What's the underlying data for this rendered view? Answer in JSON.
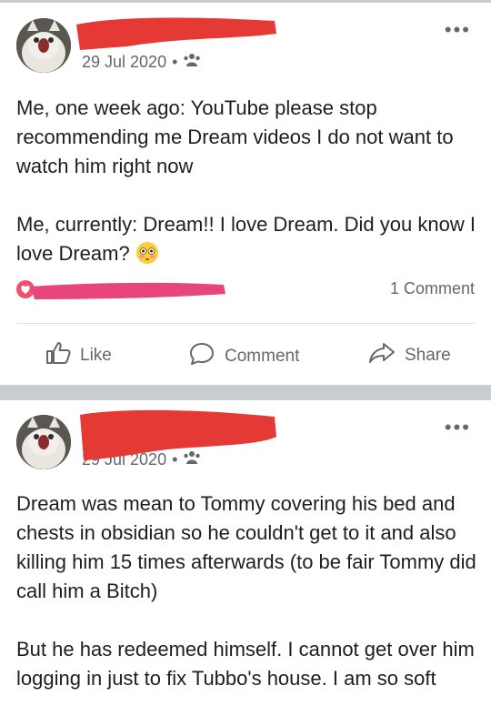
{
  "posts": [
    {
      "date": "29 Jul 2020",
      "audience_icon": "friends-icon",
      "paragraphs": [
        "Me, one week ago: YouTube please stop recommending me Dream videos I do not want to watch him right now",
        "Me, currently: Dream!! I love Dream. Did you know I love Dream?"
      ],
      "emoji": "flushed-face-emoji",
      "comment_count": "1 Comment",
      "actions": {
        "like": "Like",
        "comment": "Comment",
        "share": "Share"
      }
    },
    {
      "date": "29 Jul 2020",
      "audience_icon": "friends-icon",
      "paragraphs": [
        "Dream was mean to Tommy covering his bed and chests in obsidian so he couldn't get to it and also killing him 15 times afterwards (to be fair Tommy did call him a Bitch)",
        "But he has redeemed himself. I cannot get over him logging in just to fix Tubbo's house. I am so soft"
      ]
    }
  ],
  "colors": {
    "redaction_red": "#e53935",
    "redaction_pink": "#e8457a",
    "meta_gray": "#65676b",
    "separator": "#c9ccd1"
  }
}
